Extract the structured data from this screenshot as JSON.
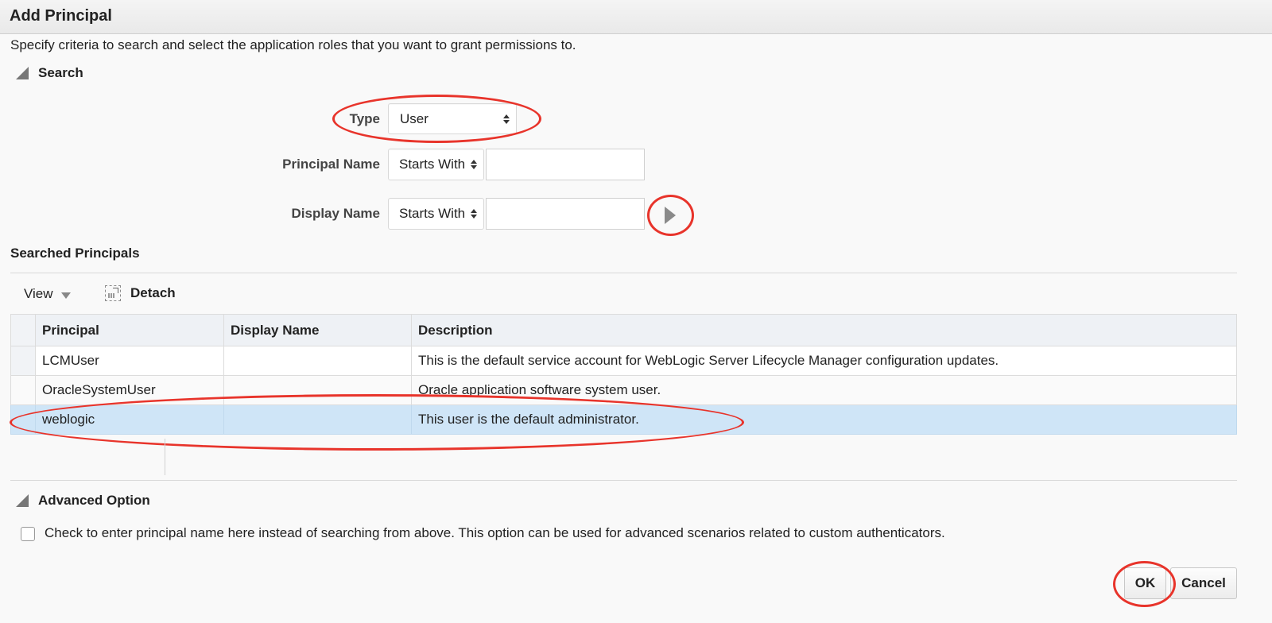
{
  "dialog": {
    "title": "Add Principal",
    "intro": "Specify criteria to search and select the application roles that you want to grant permissions to."
  },
  "search": {
    "section_label": "Search",
    "type_label": "Type",
    "type_value": "User",
    "principal_name_label": "Principal Name",
    "principal_name_operator": "Starts With",
    "principal_name_value": "",
    "display_name_label": "Display Name",
    "display_name_operator": "Starts With",
    "display_name_value": ""
  },
  "results": {
    "section_label": "Searched Principals",
    "toolbar": {
      "view_label": "View",
      "detach_label": "Detach"
    },
    "columns": [
      "Principal",
      "Display Name",
      "Description"
    ],
    "rows": [
      {
        "principal": "LCMUser",
        "display_name": "",
        "description": "This is the default service account for WebLogic Server Lifecycle Manager configuration updates."
      },
      {
        "principal": "OracleSystemUser",
        "display_name": "",
        "description": "Oracle application software system user."
      },
      {
        "principal": "weblogic",
        "display_name": "",
        "description": "This user is the default administrator.",
        "selected": true
      }
    ]
  },
  "advanced": {
    "section_label": "Advanced Option",
    "checkbox_label": "Check to enter principal name here instead of searching from above. This option can be used for advanced scenarios related to custom authenticators.",
    "checked": false
  },
  "buttons": {
    "ok_label": "OK",
    "cancel_label": "Cancel"
  },
  "colors": {
    "highlight_ring": "#e8342b",
    "selected_row": "#cfe5f7"
  }
}
